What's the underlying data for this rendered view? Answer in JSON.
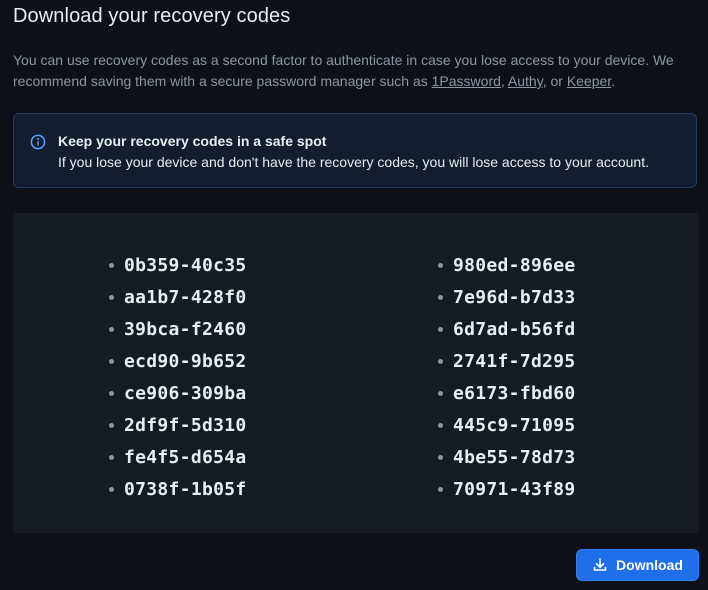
{
  "page": {
    "title": "Download your recovery codes"
  },
  "description": {
    "text_before": "You can use recovery codes as a second factor to authenticate in case you lose access to your device. We recommend saving them with a secure password manager such as ",
    "links": [
      "1Password",
      "Authy",
      "Keeper"
    ],
    "sep1": ", ",
    "sep2": ", or ",
    "text_after": "."
  },
  "notice": {
    "icon": "info-icon",
    "title": "Keep your recovery codes in a safe spot",
    "body": "If you lose your device and don't have the recovery codes, you will lose access to your account."
  },
  "codes": {
    "left": [
      "0b359-40c35",
      "aa1b7-428f0",
      "39bca-f2460",
      "ecd90-9b652",
      "ce906-309ba",
      "2df9f-5d310",
      "fe4f5-d654a",
      "0738f-1b05f"
    ],
    "right": [
      "980ed-896ee",
      "7e96d-b7d33",
      "6d7ad-b56fd",
      "2741f-7d295",
      "e6173-fbd60",
      "445c9-71095",
      "4be55-78d73",
      "70971-43f89"
    ]
  },
  "actions": {
    "download_label": "Download",
    "download_icon": "download-icon",
    "accent_color": "#1f6feb"
  }
}
